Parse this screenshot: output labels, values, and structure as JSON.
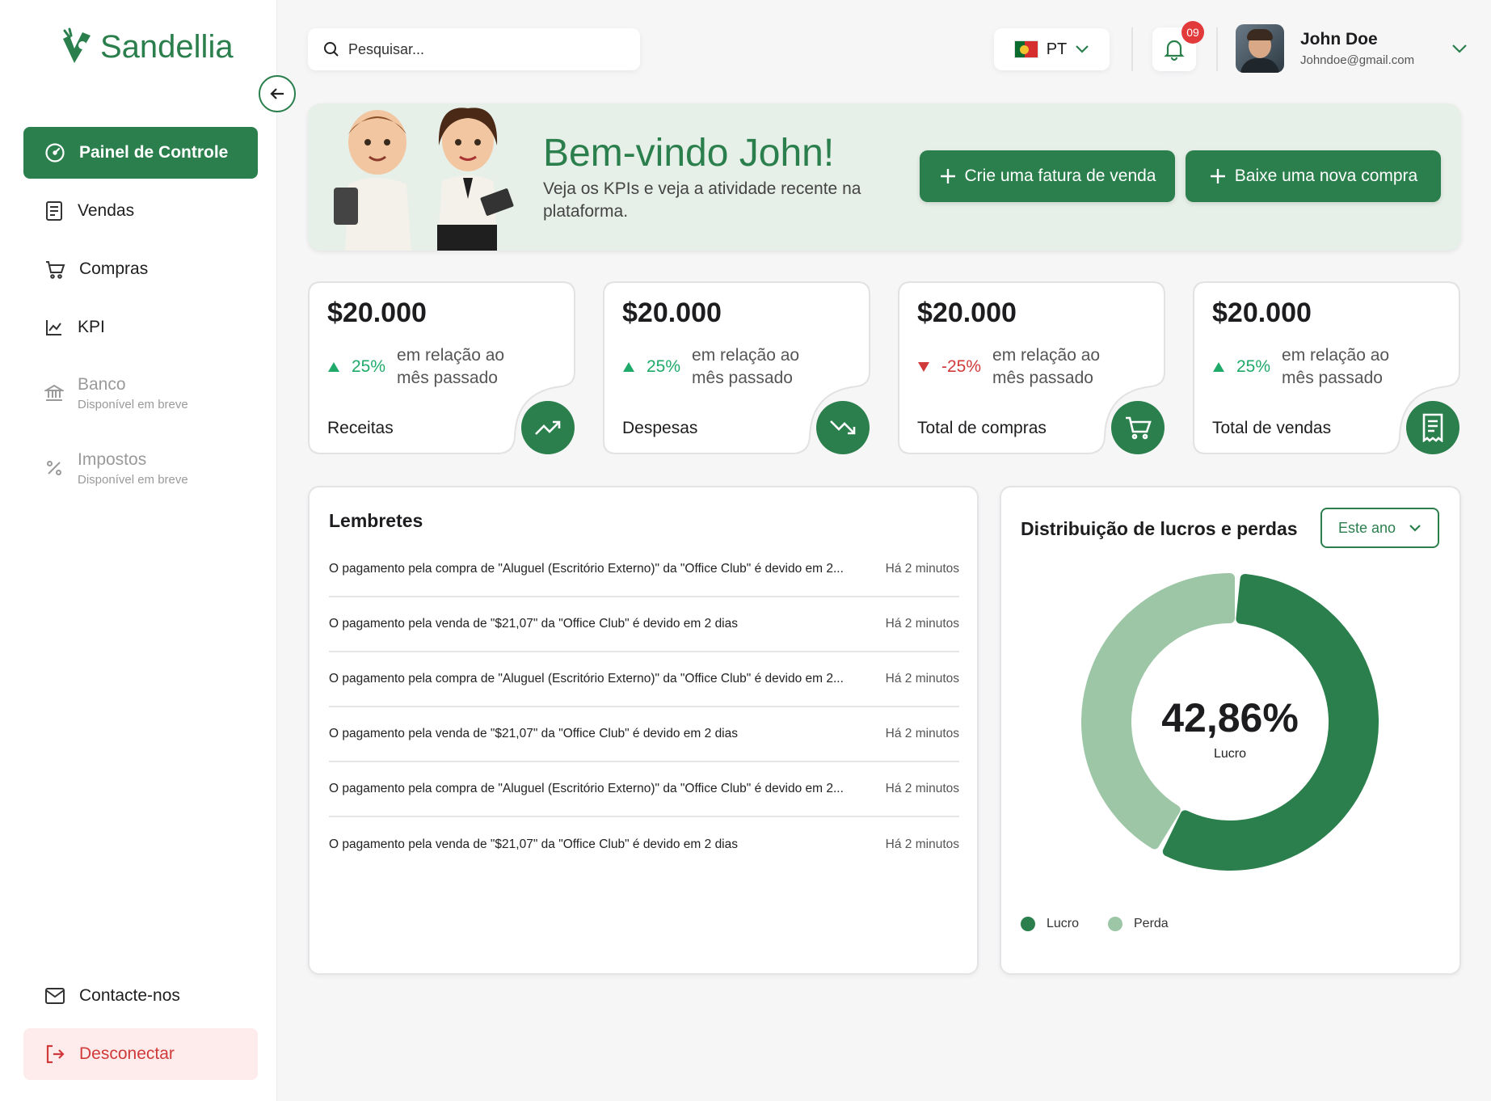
{
  "brand": {
    "name": "Sandellia"
  },
  "colors": {
    "primary": "#2a7f4c",
    "primary_light": "#9cc6a6",
    "danger": "#d13a3a",
    "positive": "#1faa6a"
  },
  "sidebar": {
    "items": [
      {
        "label": "Painel de Controle",
        "icon": "dashboard-gauge-icon",
        "active": true
      },
      {
        "label": "Vendas",
        "icon": "receipt-icon"
      },
      {
        "label": "Compras",
        "icon": "cart-icon"
      },
      {
        "label": "KPI",
        "icon": "line-chart-icon"
      },
      {
        "label": "Banco",
        "sub": "Disponível em breve",
        "icon": "bank-icon",
        "disabled": true
      },
      {
        "label": "Impostos",
        "sub": "Disponível em breve",
        "icon": "percent-icon",
        "disabled": true
      }
    ],
    "contact_label": "Contacte-nos",
    "logout_label": "Desconectar"
  },
  "topbar": {
    "search_placeholder": "Pesquisar...",
    "language": "PT",
    "notifications_count": "09",
    "user_name": "John Doe",
    "user_email": "Johndoe@gmail.com"
  },
  "banner": {
    "title": "Bem-vindo John!",
    "subtitle": "Veja os KPIs e veja a atividade recente na plataforma.",
    "btn_invoice": "Crie uma fatura de venda",
    "btn_purchase": "Baixe uma nova compra"
  },
  "kpis": [
    {
      "value": "$20.000",
      "pct": "25%",
      "direction": "up",
      "note": "em relação ao mês passado",
      "label": "Receitas",
      "icon": "trending-up-icon"
    },
    {
      "value": "$20.000",
      "pct": "25%",
      "direction": "up",
      "note": "em relação ao mês passado",
      "label": "Despesas",
      "icon": "trending-down-icon"
    },
    {
      "value": "$20.000",
      "pct": "-25%",
      "direction": "down",
      "note": "em relação ao mês passado",
      "label": "Total de compras",
      "icon": "cart-icon"
    },
    {
      "value": "$20.000",
      "pct": "25%",
      "direction": "up",
      "note": "em relação ao mês passado",
      "label": "Total de vendas",
      "icon": "receipt-icon"
    }
  ],
  "reminders": {
    "title": "Lembretes",
    "items": [
      {
        "text": "O pagamento pela compra de \"Aluguel (Escritório Externo)\" da \"Office Club\" é devido em 2...",
        "time": "Há 2 minutos"
      },
      {
        "text": "O pagamento pela venda de \"$21,07\" da \"Office Club\" é devido em 2 dias",
        "time": "Há 2 minutos"
      },
      {
        "text": "O pagamento pela compra de \"Aluguel (Escritório Externo)\" da \"Office Club\" é devido em 2...",
        "time": "Há 2 minutos"
      },
      {
        "text": "O pagamento pela venda de \"$21,07\" da \"Office Club\" é devido em 2 dias",
        "time": "Há 2 minutos"
      },
      {
        "text": "O pagamento pela compra de \"Aluguel (Escritório Externo)\" da \"Office Club\" é devido em 2...",
        "time": "Há 2 minutos"
      },
      {
        "text": "O pagamento pela venda de \"$21,07\" da \"Office Club\" é devido em 2 dias",
        "time": "Há 2 minutos"
      }
    ]
  },
  "profit_loss": {
    "title": "Distribuição de lucros e perdas",
    "period": "Este ano",
    "center_value": "42,86%",
    "center_label": "Lucro"
  },
  "chart_data": {
    "type": "pie",
    "title": "Distribuição de lucros e perdas",
    "categories": [
      "Lucro",
      "Perda"
    ],
    "values": [
      57.14,
      42.86
    ],
    "colors": [
      "#2a7f4c",
      "#9cc6a6"
    ],
    "legend": "bottom-left"
  }
}
